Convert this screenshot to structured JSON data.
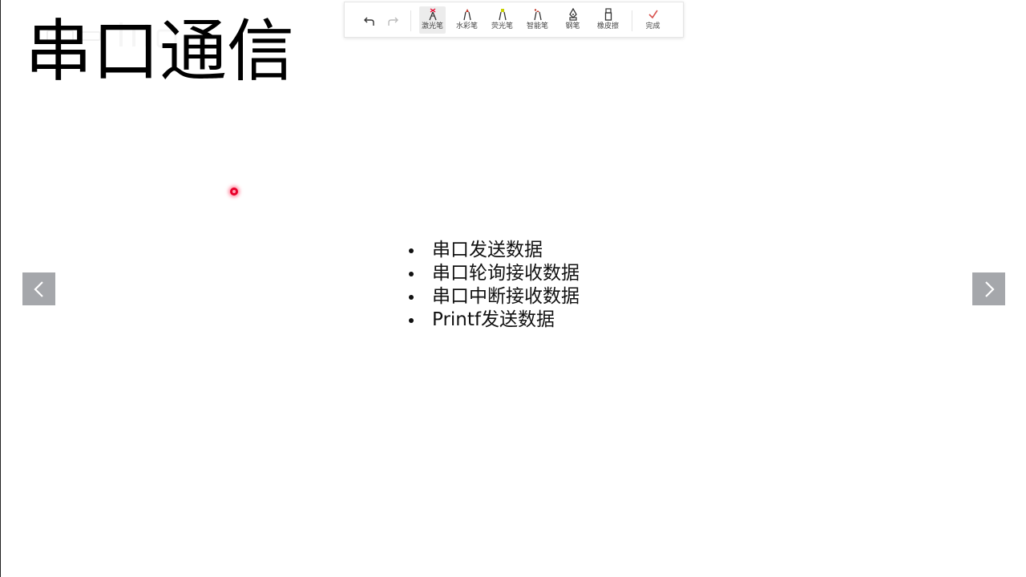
{
  "slide": {
    "title": "串口通信",
    "bullets": [
      "串口发送数据",
      "串口轮询接收数据",
      "串口中断接收数据",
      "Printf发送数据"
    ]
  },
  "navigation": {
    "prev_icon": "chevron-left-icon",
    "next_icon": "chevron-right-icon"
  },
  "toolbar": {
    "undo_icon": "undo-icon",
    "redo_icon": "redo-icon",
    "tools": [
      {
        "label": "激光笔",
        "icon": "laser-pointer-icon",
        "active": true
      },
      {
        "label": "水彩笔",
        "icon": "watercolor-pen-icon",
        "active": false
      },
      {
        "label": "荧光笔",
        "icon": "highlighter-icon",
        "active": false
      },
      {
        "label": "智能笔",
        "icon": "smart-pen-icon",
        "active": false
      },
      {
        "label": "钢笔",
        "icon": "fountain-pen-icon",
        "active": false
      },
      {
        "label": "橡皮擦",
        "icon": "eraser-icon",
        "active": false
      }
    ],
    "done_label": "完成",
    "done_icon": "check-icon"
  },
  "colors": {
    "laser": "#e8002a",
    "watercolor": "#c0392b",
    "highlighter": "#c8d000",
    "smart_pen": "#c0392b",
    "done_check": "#d9534f",
    "nav_button": "#a5a7ab"
  }
}
